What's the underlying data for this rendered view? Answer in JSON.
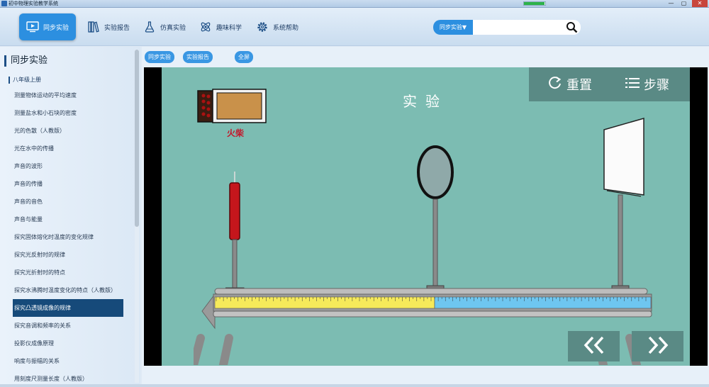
{
  "window": {
    "title": "初中物理实验教学系统",
    "progress": 0.95,
    "minimize": "—",
    "maximize": "▢",
    "close": "✕"
  },
  "nav": {
    "items": [
      {
        "label": "同步实验",
        "icon": "monitor-play-icon",
        "active": true
      },
      {
        "label": "实验报告",
        "icon": "books-icon",
        "active": false
      },
      {
        "label": "仿真实验",
        "icon": "flask-icon",
        "active": false
      },
      {
        "label": "趣味科学",
        "icon": "atom-icon",
        "active": false
      },
      {
        "label": "系统帮助",
        "icon": "gear-icon",
        "active": false
      }
    ],
    "search": {
      "scope": "同步实验▼",
      "placeholder": "",
      "value": ""
    }
  },
  "sidebar": {
    "title": "同步实验",
    "subtitle": "八年级上册",
    "items": [
      "测量物体运动的平均速度",
      "测量盐水和小石块的密度",
      "光的色散（人教版）",
      "光在水中的传播",
      "声音的波形",
      "声音的传播",
      "声音的音色",
      "声音与能量",
      "探究固体熔化时温度的变化规律",
      "探究光反射时的规律",
      "探究光折射时的特点",
      "探究水沸腾时温度变化的特点（人教版）",
      "探究凸透镜成像的规律",
      "探究音调和频率的关系",
      "投影仪成像原理",
      "响度与振幅的关系",
      "用刻度尺测量长度（人教版）"
    ],
    "selected_index": 12
  },
  "content": {
    "tabs": [
      "同步实验",
      "实验报告"
    ],
    "fullscreen": "全屏",
    "scene": {
      "title": "实验",
      "match_label": "火柴",
      "reset_label": "重置",
      "steps_label": "步骤",
      "prev_icon": "double-chevron-left-icon",
      "next_icon": "double-chevron-right-icon"
    },
    "colors": {
      "scene_bg": "#7cbcb2",
      "control_bg": "#5a8a85",
      "accent": "#2c8fe0",
      "selected_item": "#164a7a"
    }
  }
}
